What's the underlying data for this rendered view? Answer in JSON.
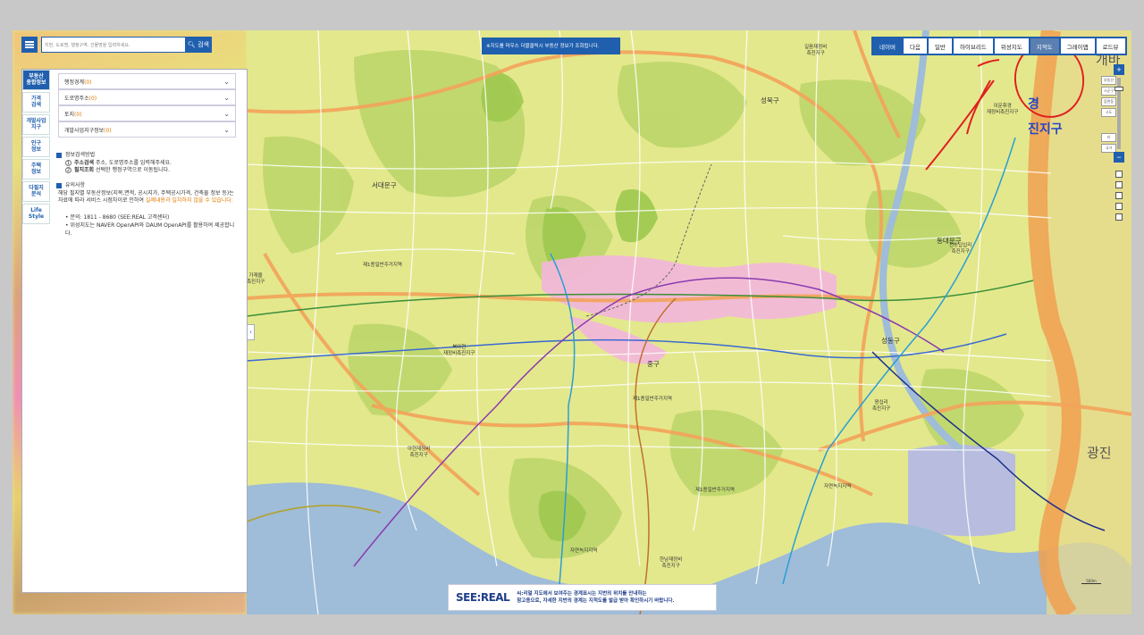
{
  "search": {
    "placeholder": "지번, 도로명, 행정구역, 건물명을 입력하세요.",
    "button_label": "검색"
  },
  "notice": "※지도를 마우스 더블클릭시 부동산 정보가 조회됩니다.",
  "map_tabs": [
    {
      "label": "네이버",
      "state": "active"
    },
    {
      "label": "다음",
      "state": ""
    },
    {
      "label": "일반",
      "state": ""
    },
    {
      "label": "하이브리드",
      "state": ""
    },
    {
      "label": "위성지도",
      "state": ""
    },
    {
      "label": "지적도",
      "state": "highlighted"
    },
    {
      "label": "그레이맵",
      "state": ""
    },
    {
      "label": "로드뷰",
      "state": ""
    }
  ],
  "side_nav": [
    {
      "label": "부동산\n종합정보",
      "active": true
    },
    {
      "label": "가격\n검색",
      "active": false
    },
    {
      "label": "개발사업\n지구",
      "active": false
    },
    {
      "label": "인구\n정보",
      "active": false
    },
    {
      "label": "주택\n정보",
      "active": false
    },
    {
      "label": "다필지\n분석",
      "active": false
    },
    {
      "label": "Life\nStyle",
      "active": false
    }
  ],
  "accordion": [
    {
      "label": "행정경계",
      "count": "(0)"
    },
    {
      "label": "도로명주소",
      "count": "(0)"
    },
    {
      "label": "토지",
      "count": "(0)"
    },
    {
      "label": "개발사업지구정보",
      "count": "(0)"
    }
  ],
  "guide": {
    "usage_title": "정보검색방법",
    "step1_bold": "주소검색",
    "step1_text": "주소, 도로명주소를 입력해주세요.",
    "step2_bold": "필지조회",
    "step2_text": "선택한 행정구역으로 이동됩니다.",
    "notice_title": "유의사항",
    "notice_text": "해당 필지별 부동산정보(지목,면적, 공시지가, 주택공시가격, 건축물 정보 등)는 자료에 따라 서비스 시점차이로 인하여",
    "notice_orange": "실제내용과 일치하지 않을 수 있습니다.",
    "contact": "문의: 1811 - 8680 (SEE:REAL 고객센터)",
    "satellite_note": "위성지도는 NAVER OpenAPI와 DAUM OpenAPI를 활용하여 제공합니다."
  },
  "map_labels": {
    "seongbuk": "성북구",
    "seodaemun": "서대문구",
    "jung": "중구",
    "dongdaemun": "동대문구",
    "seongdong": "성동구",
    "gwangjin": "광진",
    "district_big": "경",
    "district_big2": "진지구",
    "gaeban": "개바",
    "zone1": "제1종일반주거지역",
    "zone2": "제1종일반주거지역",
    "zone3": "제1종일반주거지역",
    "zone4": "자연녹지지역",
    "zone5": "자연녹지지역",
    "promo1": "길음재정비\n촉진지구",
    "promo2": "아현재정비\n촉진지구",
    "promo3": "북아현\n재정비촉진지구",
    "promo4": "한남재정비\n촉진지구",
    "promo5": "전농답십리\n촉진지구",
    "promo6": "이문휘경\n재정비촉진지구",
    "promo7": "가재울\n촉진지구",
    "promo8": "왕십리\n촉진지구"
  },
  "zoom_labels": [
    "부동산",
    "시군구",
    "읍면동",
    "시도",
    "리",
    "시도",
    "국가"
  ],
  "banner": {
    "logo": "SEE:REAL",
    "line1": "씨:리얼 지도에서 보여주는 경계표시는 지번의 위치를 안내하는",
    "line2": "참고용으로, 자세한 지번의 경계는 지적도를 발급 받아 확인하시기 바랍니다."
  },
  "scale": "500m",
  "colors": {
    "primary": "#1f5fae",
    "accent": "#e07a00",
    "annotation": "#e02020"
  }
}
